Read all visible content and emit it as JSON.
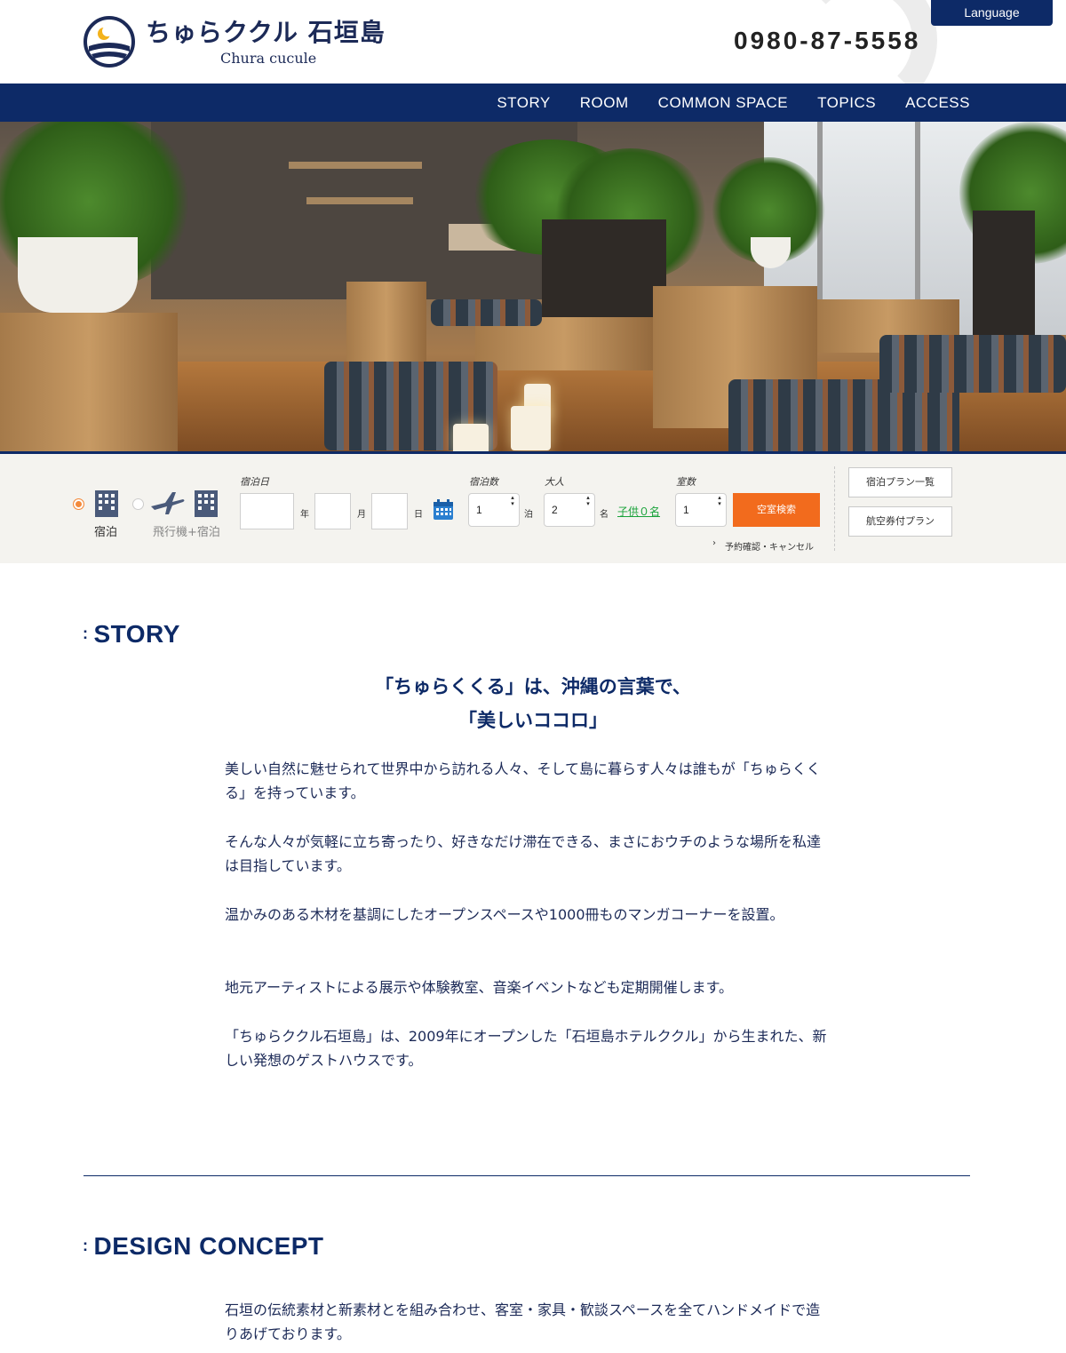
{
  "header": {
    "logo_jp": "ちゅらククル 石垣島",
    "logo_en": "Chura cucule",
    "phone": "0980-87-5558",
    "language_label": "Language"
  },
  "nav": {
    "items": [
      "STORY",
      "ROOM",
      "COMMON SPACE",
      "TOPICS",
      "ACCESS"
    ]
  },
  "search": {
    "mode_stay": "宿泊",
    "mode_flight": "飛行機+宿泊",
    "date_label": "宿泊日",
    "year_unit": "年",
    "month_unit": "月",
    "day_unit": "日",
    "nights_label": "宿泊数",
    "nights_value": "1",
    "nights_unit": "泊",
    "adults_label": "大人",
    "adults_value": "2",
    "adults_unit": "名",
    "children_link": "子供０名",
    "rooms_label": "室数",
    "rooms_value": "1",
    "search_button": "空室検索",
    "cancel_link": "予約確認・キャンセル",
    "plan_list_button": "宿泊プラン一覧",
    "flight_plan_button": "航空券付プラン"
  },
  "story": {
    "title": "STORY",
    "lead_1": "「ちゅらくくる」は、沖縄の言葉で、",
    "lead_2": "「美しいココロ」",
    "p1": "美しい自然に魅せられて世界中から訪れる人々、そして島に暮らす人々は誰もが「ちゅらくくる」を持っています。",
    "p2": "そんな人々が気軽に立ち寄ったり、好きなだけ滞在できる、まさにおウチのような場所を私達は目指しています。",
    "p3": "温かみのある木材を基調にしたオープンスペースや1000冊ものマンガコーナーを設置。",
    "p4": "地元アーティストによる展示や体験教室、音楽イベントなども定期開催します。",
    "p5": "「ちゅらククル石垣島」は、2009年にオープンした「石垣島ホテルククル」から生まれた、新しい発想のゲストハウスです。"
  },
  "design": {
    "title": "DESIGN CONCEPT",
    "p1": "石垣の伝統素材と新素材とを組み合わせ、客室・家具・歓談スペースを全てハンドメイドで造りあげております。"
  },
  "colors": {
    "navy": "#0d2a67",
    "orange": "#f26b1d",
    "green": "#19a23a"
  }
}
